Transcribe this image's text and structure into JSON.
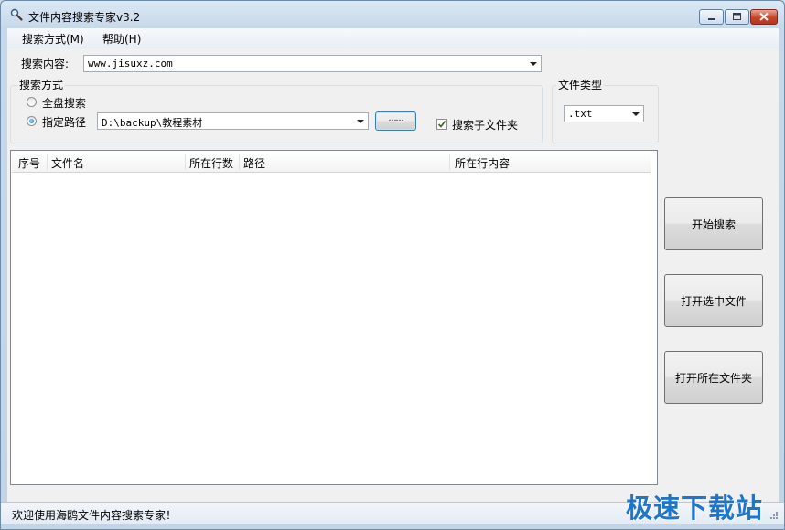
{
  "window": {
    "title": "文件内容搜索专家v3.2"
  },
  "menu": {
    "items": [
      {
        "label": "搜索方式(M)"
      },
      {
        "label": "帮助(H)"
      }
    ]
  },
  "search": {
    "label": "搜索内容:",
    "value": "www.jisuxz.com"
  },
  "search_mode": {
    "group_title": "搜索方式",
    "options": [
      {
        "label": "全盘搜索",
        "selected": false
      },
      {
        "label": "指定路径",
        "selected": true
      }
    ],
    "path_value": "D:\\backup\\教程素材",
    "browse_label": "……",
    "subfolder_label": "搜索子文件夹",
    "subfolder_checked": true
  },
  "file_type": {
    "group_title": "文件类型",
    "value": ".txt"
  },
  "results": {
    "columns": [
      "序号",
      "文件名",
      "所在行数",
      "路径",
      "所在行内容"
    ],
    "rows": []
  },
  "actions": {
    "start": "开始搜索",
    "open_selected": "打开选中文件",
    "open_folder": "打开所在文件夹"
  },
  "status": {
    "text": "欢迎使用海鸥文件内容搜索专家！"
  },
  "watermark": {
    "text": "极速下载站"
  }
}
